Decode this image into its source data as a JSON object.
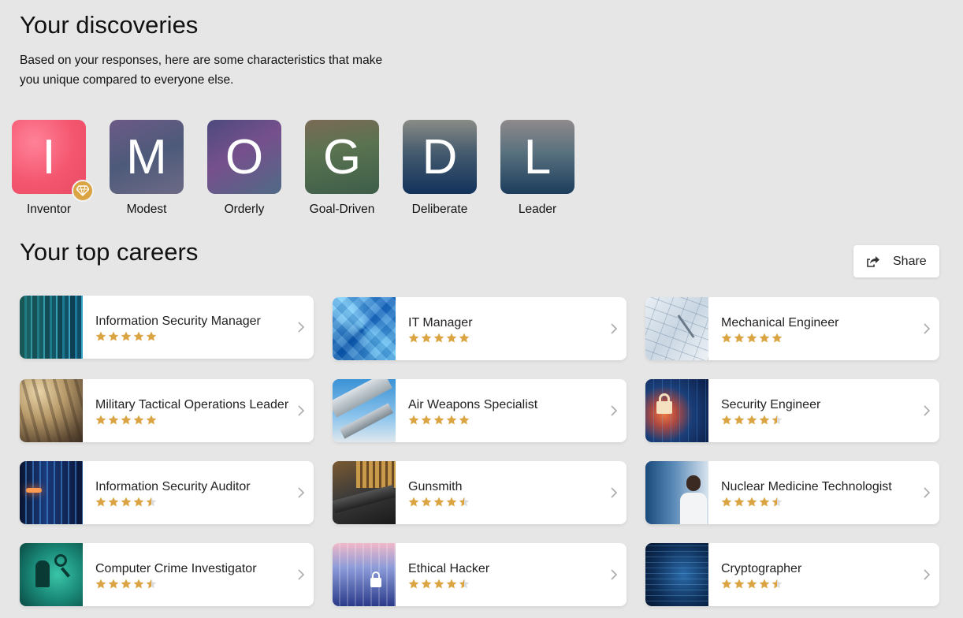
{
  "discoveries": {
    "title": "Your discoveries",
    "intro": "Based on your responses, here are some characteristics that make you unique compared to everyone else.",
    "traits": [
      {
        "letter": "I",
        "label": "Inventor",
        "badge": true
      },
      {
        "letter": "M",
        "label": "Modest"
      },
      {
        "letter": "O",
        "label": "Orderly"
      },
      {
        "letter": "G",
        "label": "Goal-Driven"
      },
      {
        "letter": "D",
        "label": "Deliberate"
      },
      {
        "letter": "L",
        "label": "Leader"
      }
    ]
  },
  "careers": {
    "title": "Your top careers",
    "share_label": "Share",
    "items": [
      {
        "title": "Information Security Manager",
        "rating": 5
      },
      {
        "title": "IT Manager",
        "rating": 5
      },
      {
        "title": "Mechanical Engineer",
        "rating": 5
      },
      {
        "title": "Military Tactical Operations Leader",
        "rating": 5
      },
      {
        "title": "Air Weapons Specialist",
        "rating": 5
      },
      {
        "title": "Security Engineer",
        "rating": 4.5
      },
      {
        "title": "Information Security Auditor",
        "rating": 4.5
      },
      {
        "title": "Gunsmith",
        "rating": 4.5
      },
      {
        "title": "Nuclear Medicine Technologist",
        "rating": 4.5
      },
      {
        "title": "Computer Crime Investigator",
        "rating": 4.5
      },
      {
        "title": "Ethical Hacker",
        "rating": 4.5
      },
      {
        "title": "Cryptographer",
        "rating": 4.5
      }
    ]
  },
  "colors": {
    "star": "#d9a441",
    "star_empty": "#dcdcdc",
    "badge": "#d9a441"
  }
}
